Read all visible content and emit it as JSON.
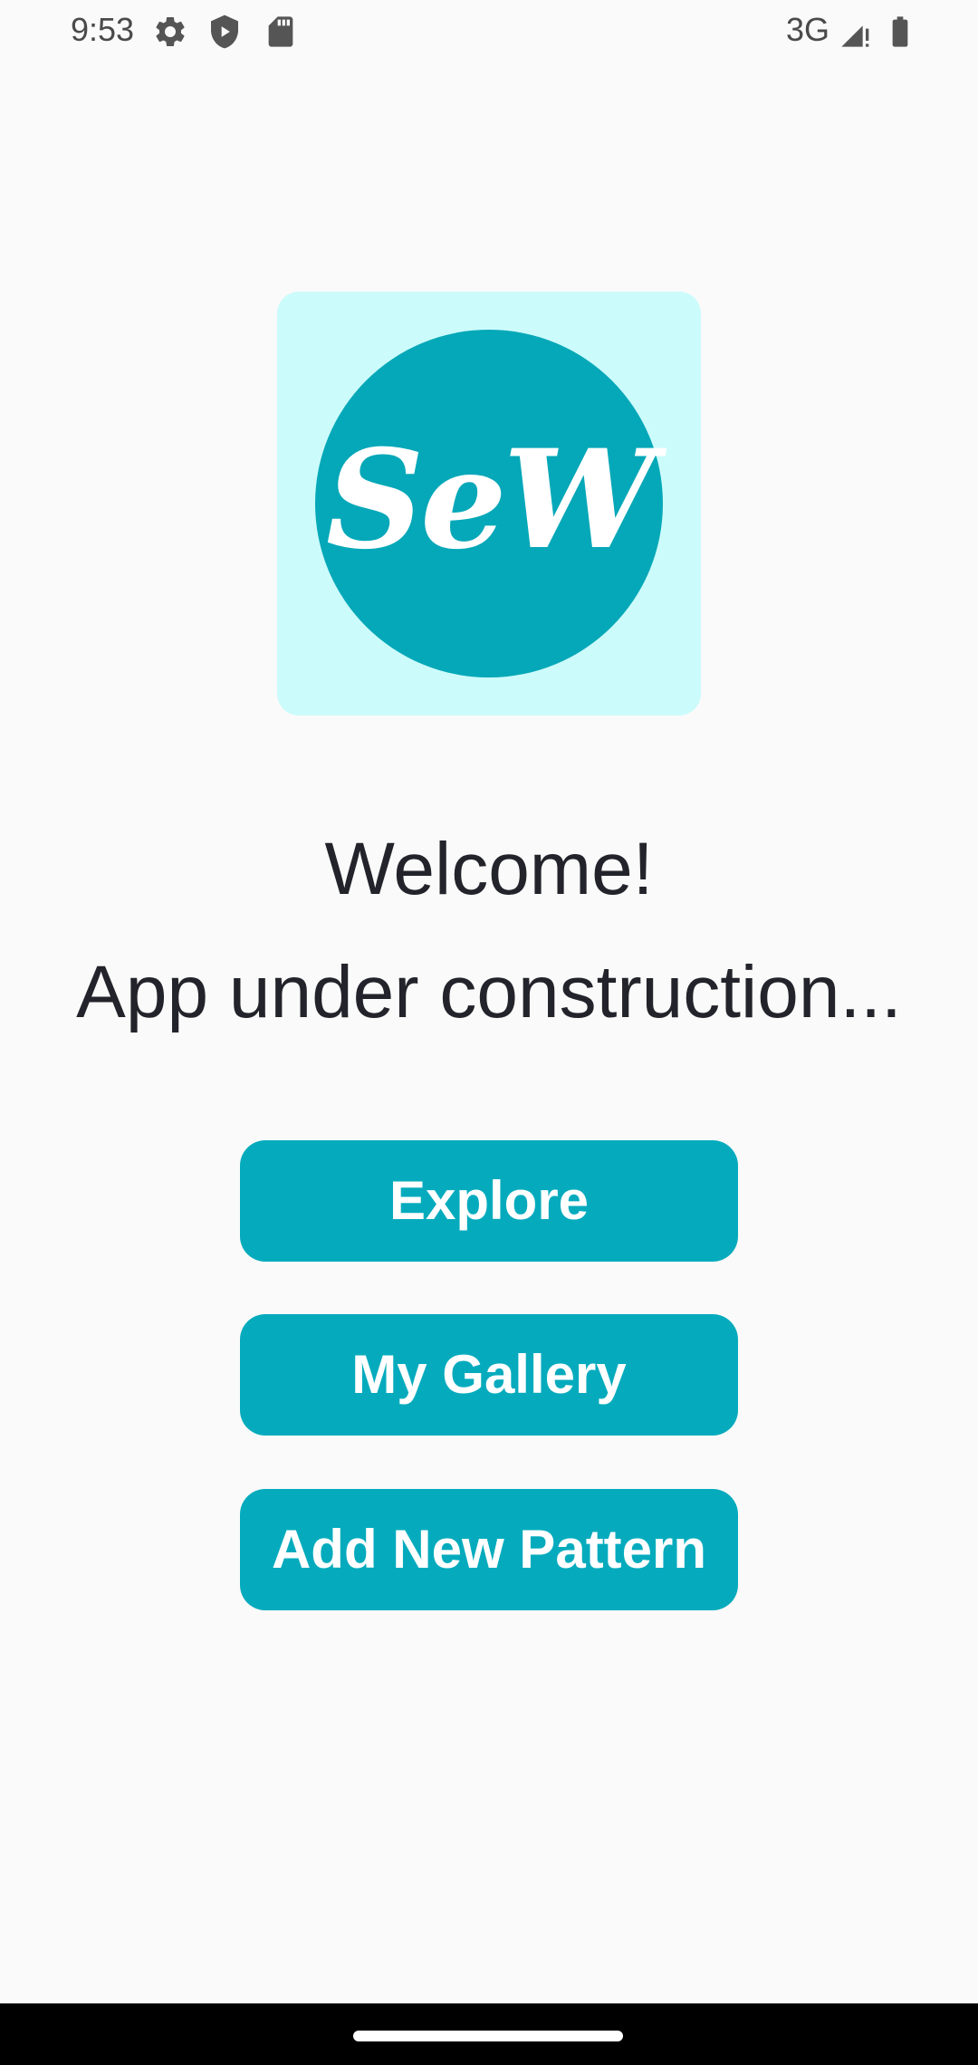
{
  "status_bar": {
    "time": "9:53",
    "network": "3G",
    "icons": [
      "settings-icon",
      "shield-icon",
      "sd-card-icon",
      "signal-icon",
      "battery-icon"
    ]
  },
  "logo": {
    "text": "SeW",
    "tile_color": "#ccfbfb",
    "circle_color": "#05a8b8"
  },
  "main": {
    "welcome": "Welcome!",
    "subtitle": "App under construction..."
  },
  "buttons": {
    "explore": "Explore",
    "gallery": "My Gallery",
    "add_pattern": "Add New Pattern"
  },
  "colors": {
    "accent": "#05abbd",
    "background": "#fafafa",
    "text": "#23232b"
  }
}
